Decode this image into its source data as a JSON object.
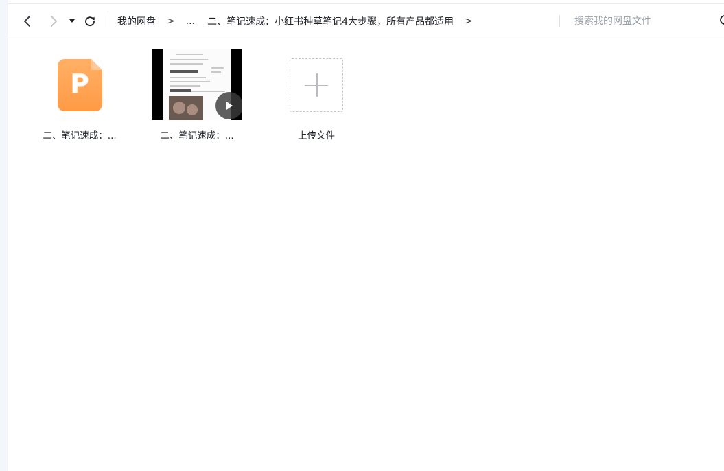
{
  "toolbar": {
    "back_icon": "chevron-left-icon",
    "forward_icon": "chevron-right-icon",
    "dropdown_icon": "caret-down-icon",
    "refresh_icon": "refresh-icon"
  },
  "breadcrumb": {
    "root": "我的网盘",
    "sep": ">",
    "ellipsis": "...",
    "current": "二、笔记速成：小红书种草笔记4大步骤，所有产品都适用",
    "trailing_sep": ">"
  },
  "search": {
    "placeholder": "搜索我的网盘文件",
    "icon": "search-icon"
  },
  "files": [
    {
      "name": "二、笔记速成：...",
      "type": "ppt",
      "icon_letter": "P",
      "icon": "ppt-file-icon"
    },
    {
      "name": "二、笔记速成：...",
      "type": "video",
      "icon": "play-icon"
    }
  ],
  "upload": {
    "label": "上传文件",
    "icon": "plus-icon"
  },
  "colors": {
    "ppt_orange": "#ff9a45",
    "text": "#1f2329",
    "muted": "#9aa0a8",
    "border": "#eceef1"
  }
}
